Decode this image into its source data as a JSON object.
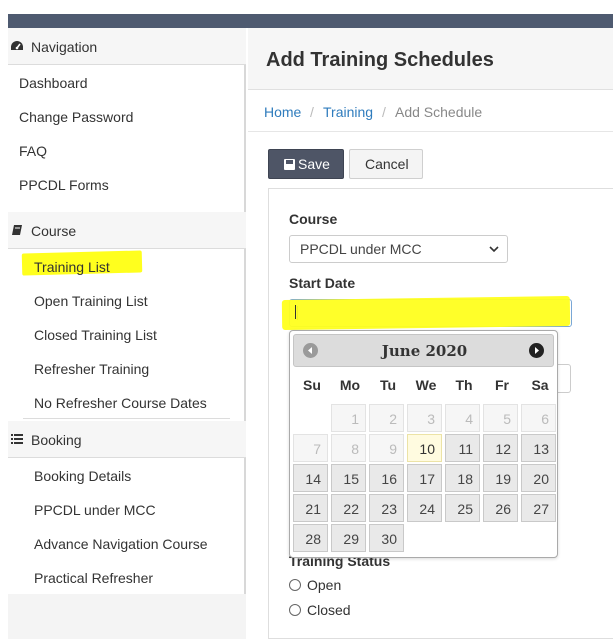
{
  "sidebar": {
    "navigation": {
      "title": "Navigation",
      "items": [
        "Dashboard",
        "Change Password",
        "FAQ",
        "PPCDL Forms"
      ]
    },
    "course": {
      "title": "Course",
      "items": [
        "Training List",
        "Open Training List",
        "Closed Training List",
        "Refresher Training",
        "No Refresher Course Dates"
      ]
    },
    "booking": {
      "title": "Booking",
      "items": [
        "Booking Details",
        "PPCDL under MCC",
        "Advance Navigation Course",
        "Practical Refresher"
      ]
    }
  },
  "page": {
    "title": "Add Training Schedules",
    "breadcrumb": [
      "Home",
      "Training",
      "Add Schedule"
    ],
    "breadcrumb_separator": "/"
  },
  "toolbar": {
    "save_label": "Save",
    "cancel_label": "Cancel"
  },
  "form": {
    "course_label": "Course",
    "course_value": "PPCDL under MCC",
    "start_date_label": "Start Date",
    "start_date_value": "",
    "training_status_label": "Training Status",
    "status_options": [
      "Open",
      "Closed"
    ]
  },
  "datepicker": {
    "title": "June 2020",
    "weekdays": [
      "Su",
      "Mo",
      "Tu",
      "We",
      "Th",
      "Fr",
      "Sa"
    ],
    "weeks": [
      [
        null,
        "1",
        "2",
        "3",
        "4",
        "5",
        "6"
      ],
      [
        "7",
        "8",
        "9",
        "10",
        "11",
        "12",
        "13"
      ],
      [
        "14",
        "15",
        "16",
        "17",
        "18",
        "19",
        "20"
      ],
      [
        "21",
        "22",
        "23",
        "24",
        "25",
        "26",
        "27"
      ],
      [
        "28",
        "29",
        "30",
        null,
        null,
        null,
        null
      ]
    ],
    "disabled_days": [
      "1",
      "2",
      "3",
      "4",
      "5",
      "6",
      "7",
      "8",
      "9"
    ],
    "today": "10"
  },
  "colors": {
    "highlight": "#ffff1e",
    "topbar": "#4e5a70",
    "link": "#2f7cbd",
    "save_button": "#4e5566"
  }
}
